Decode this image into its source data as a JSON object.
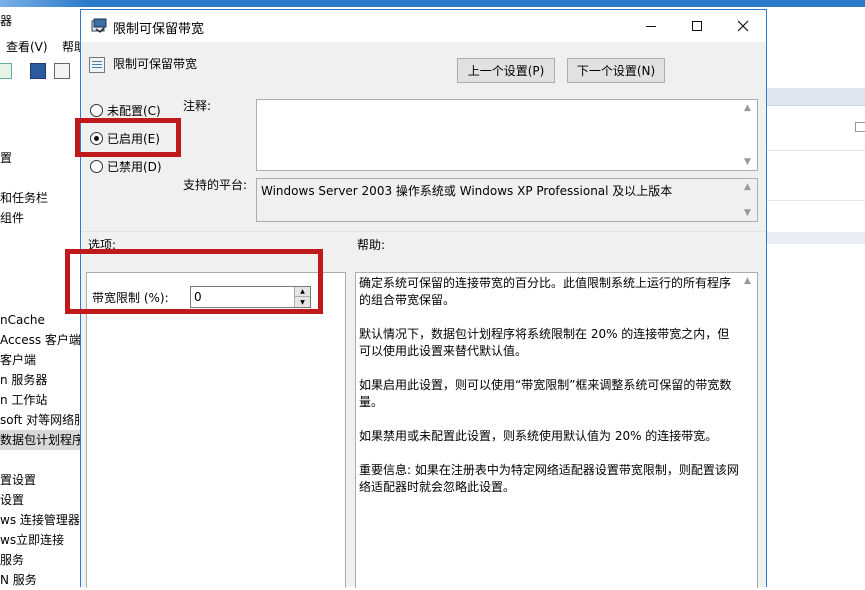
{
  "background": {
    "title_fragment": "器",
    "menu": [
      {
        "label": "查看(V)"
      },
      {
        "label": "帮助"
      }
    ],
    "tree_items": [
      {
        "label": "置"
      },
      {
        "label": "和任务栏"
      },
      {
        "label": "组件"
      },
      {
        "label": "nCache"
      },
      {
        "label": "Access 客户端优"
      },
      {
        "label": "客户端"
      },
      {
        "label": "n 服务器"
      },
      {
        "label": "n 工作站"
      },
      {
        "label": "soft 对等网络服"
      },
      {
        "label": "数据包计划程序"
      },
      {
        "label": "置设置"
      },
      {
        "label": "设置"
      },
      {
        "label": "ws 连接管理器"
      },
      {
        "label": "ws立即连接"
      },
      {
        "label": "服务"
      },
      {
        "label": "N 服务"
      }
    ]
  },
  "dialog": {
    "title": "限制可保留带宽",
    "policy_name": "限制可保留带宽",
    "prev_button": "上一个设置(P)",
    "next_button": "下一个设置(N)",
    "radios": [
      {
        "label": "未配置(C)",
        "checked": false
      },
      {
        "label": "已启用(E)",
        "checked": true
      },
      {
        "label": "已禁用(D)",
        "checked": false
      }
    ],
    "comment_label": "注释:",
    "comment_value": "",
    "platform_label": "支持的平台:",
    "platform_value": "Windows Server 2003 操作系统或 Windows XP Professional 及以上版本",
    "options_label": "选项:",
    "help_label": "帮助:",
    "bandwidth_label": "带宽限制 (%):",
    "bandwidth_value": "0",
    "help_paragraphs": [
      "确定系统可保留的连接带宽的百分比。此值限制系统上运行的所有程序的组合带宽保留。",
      "默认情况下，数据包计划程序将系统限制在 20% 的连接带宽之内，但可以使用此设置来替代默认值。",
      "如果启用此设置，则可以使用“带宽限制”框来调整系统可保留的带宽数量。",
      "如果禁用或未配置此设置，则系统使用默认值为 20% 的连接带宽。",
      "重要信息: 如果在注册表中为特定网络适配器设置带宽限制，则配置该网络适配器时就会忽略此设置。"
    ]
  },
  "colors": {
    "annotation_red": "#c0191b",
    "dialog_border": "#2d7bd0",
    "window_bg": "#f0f0f0"
  }
}
